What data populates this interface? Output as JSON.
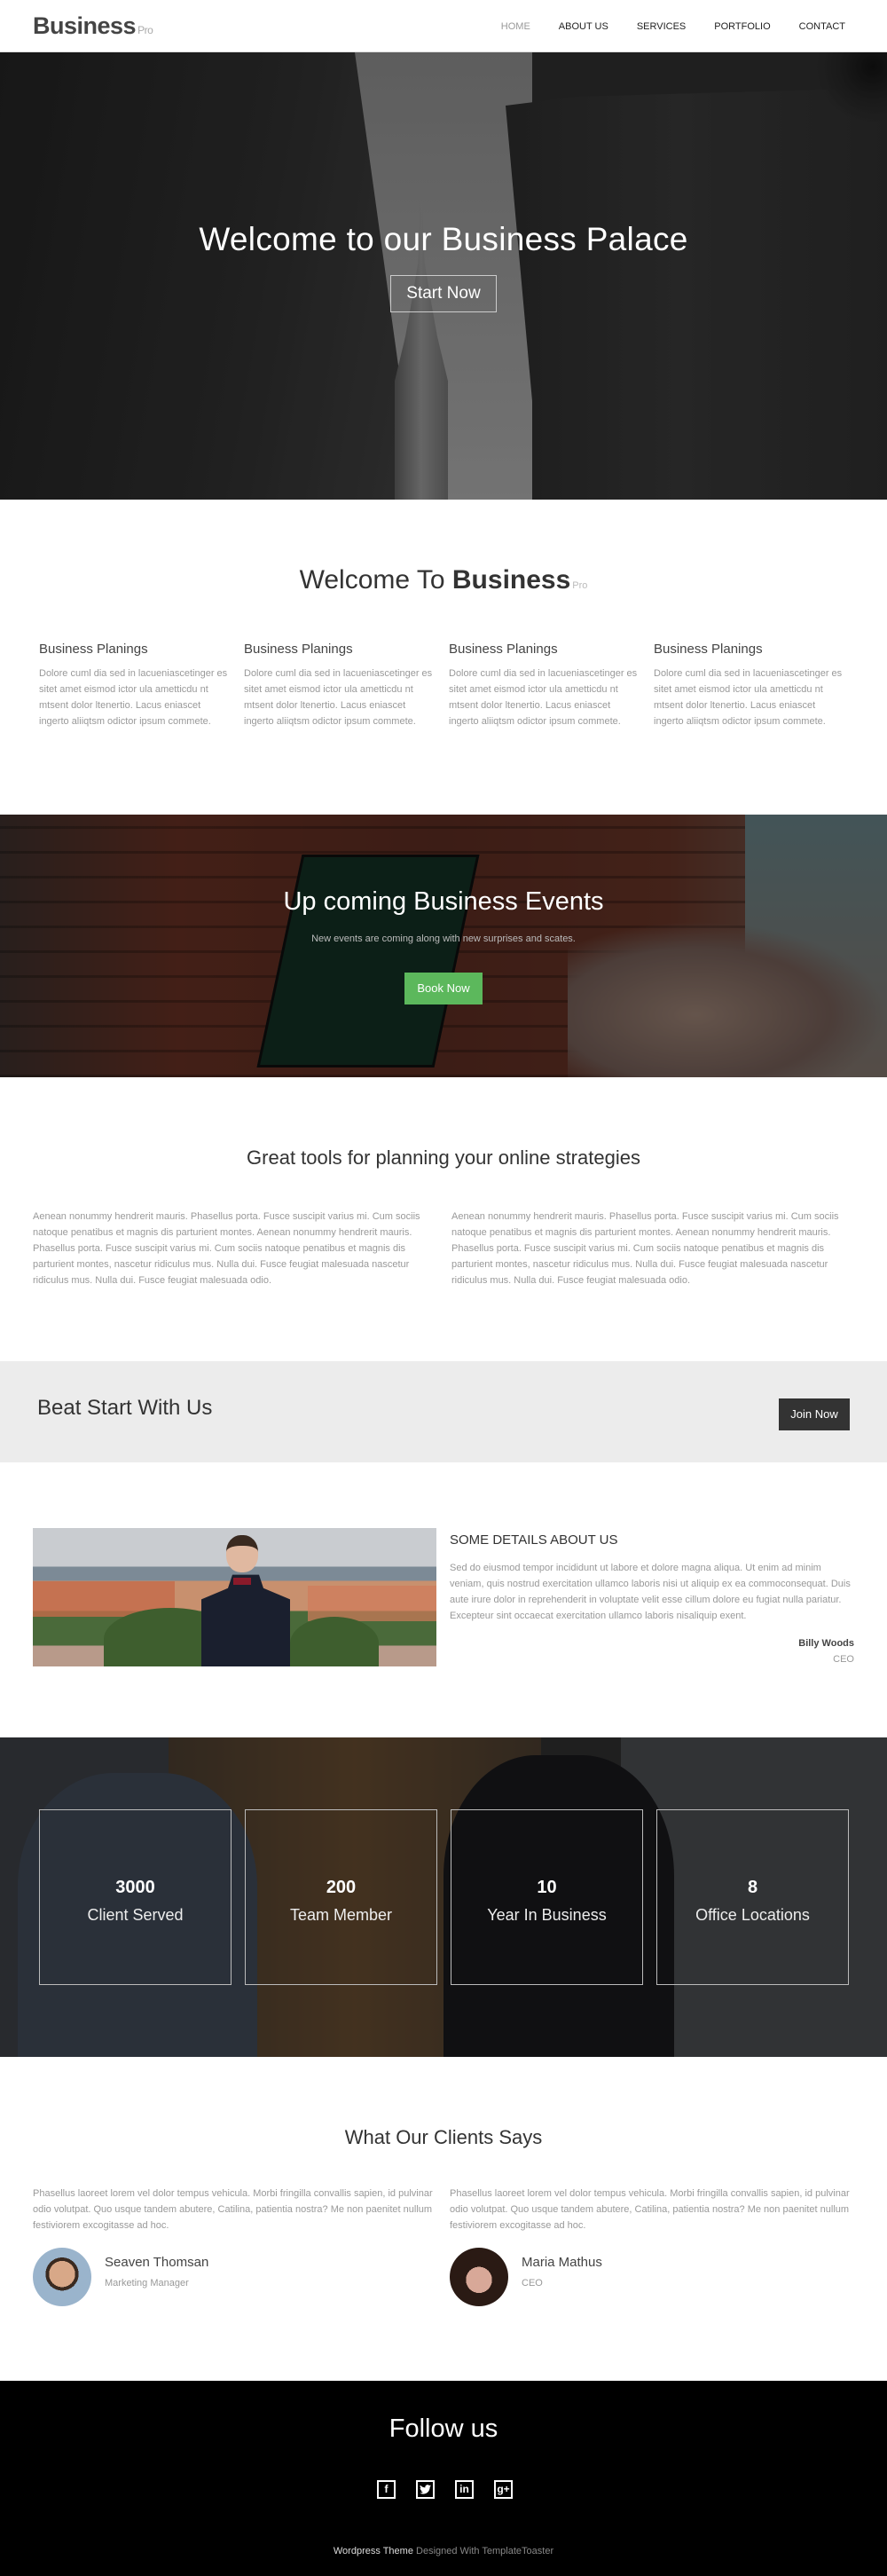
{
  "header": {
    "logo": "Business",
    "logo_sup": "Pro",
    "nav": [
      {
        "label": "HOME",
        "active": true
      },
      {
        "label": "ABOUT US",
        "active": false
      },
      {
        "label": "SERVICES",
        "active": false
      },
      {
        "label": "PORTFOLIO",
        "active": false
      },
      {
        "label": "CONTACT",
        "active": false
      }
    ]
  },
  "hero": {
    "title": "Welcome to our Business Palace",
    "button": "Start Now"
  },
  "welcome": {
    "title_prefix": "Welcome To",
    "title_bold": "Business",
    "title_sup": "Pro",
    "columns": [
      {
        "title": "Business Planings",
        "text": "Dolore cuml dia sed in lacueniascetinger es sitet amet eismod ictor ula ametticdu nt mtsent dolor ltenertio. Lacus eniascet ingerto aliiqtsm odictor ipsum commete."
      },
      {
        "title": "Business Planings",
        "text": "Dolore cuml dia sed in lacueniascetinger es sitet amet eismod ictor ula ametticdu nt mtsent dolor ltenertio. Lacus eniascet ingerto aliiqtsm odictor ipsum commete."
      },
      {
        "title": "Business Planings",
        "text": "Dolore cuml dia sed in lacueniascetinger es sitet amet eismod ictor ula ametticdu nt mtsent dolor ltenertio. Lacus eniascet ingerto aliiqtsm odictor ipsum commete."
      },
      {
        "title": "Business Planings",
        "text": "Dolore cuml dia sed in lacueniascetinger es sitet amet eismod ictor ula ametticdu nt mtsent dolor ltenertio. Lacus eniascet ingerto aliiqtsm odictor ipsum commete."
      }
    ]
  },
  "events": {
    "title": "Up coming Business Events",
    "subtitle": "New events are coming along with new surprises and scates.",
    "button": "Book Now",
    "button_color": "#5cb85c"
  },
  "tools": {
    "title": "Great tools for planning your online strategies",
    "paragraphs": [
      "Aenean nonummy hendrerit mauris. Phasellus porta. Fusce suscipit varius mi. Cum sociis natoque penatibus et magnis dis parturient montes. Aenean nonummy hendrerit mauris. Phasellus porta. Fusce suscipit varius mi. Cum sociis natoque penatibus et magnis dis parturient montes, nascetur ridiculus mus. Nulla dui. Fusce feugiat malesuada nascetur ridiculus mus. Nulla dui. Fusce feugiat malesuada odio.",
      "Aenean nonummy hendrerit mauris. Phasellus porta. Fusce suscipit varius mi. Cum sociis natoque penatibus et magnis dis parturient montes. Aenean nonummy hendrerit mauris. Phasellus porta. Fusce suscipit varius mi. Cum sociis natoque penatibus et magnis dis parturient montes, nascetur ridiculus mus. Nulla dui. Fusce feugiat malesuada nascetur ridiculus mus. Nulla dui. Fusce feugiat malesuada odio."
    ]
  },
  "cta": {
    "title": "Beat Start With Us",
    "button": "Join Now"
  },
  "about": {
    "title": "SOME DETAILS ABOUT US",
    "text": "Sed do eiusmod tempor incididunt ut labore et dolore magna aliqua. Ut enim ad minim veniam, quis nostrud exercitation ullamco laboris nisi ut aliquip ex ea commoconsequat. Duis aute irure dolor in reprehenderit in voluptate velit esse cillum dolore eu fugiat nulla pariatur. Excepteur sint occaecat exercitation ullamco laboris nisaliquip exent.",
    "author": "Billy Woods",
    "author_role": "CEO"
  },
  "stats": [
    {
      "value": "3000",
      "label": "Client Served"
    },
    {
      "value": "200",
      "label": "Team Member"
    },
    {
      "value": "10",
      "label": "Year In Business"
    },
    {
      "value": "8",
      "label": "Office Locations"
    }
  ],
  "clients": {
    "title": "What Our Clients Says",
    "testimonials": [
      {
        "text": "Phasellus laoreet lorem vel dolor tempus vehicula. Morbi fringilla convallis sapien, id pulvinar odio volutpat. Quo usque tandem abutere, Catilina, patientia nostra? Me non paenitet nullum festiviorem excogitasse ad hoc.",
        "name": "Seaven Thomsan",
        "role": "Marketing Manager"
      },
      {
        "text": "Phasellus laoreet lorem vel dolor tempus vehicula. Morbi fringilla convallis sapien, id pulvinar odio volutpat. Quo usque tandem abutere, Catilina, patientia nostra? Me non paenitet nullum festiviorem excogitasse ad hoc.",
        "name": "Maria Mathus",
        "role": "CEO"
      }
    ]
  },
  "footer": {
    "title": "Follow us",
    "social": [
      {
        "icon": "facebook-icon",
        "glyph": "f"
      },
      {
        "icon": "twitter-icon",
        "glyph": "t"
      },
      {
        "icon": "linkedin-icon",
        "glyph": "in"
      },
      {
        "icon": "google-plus-icon",
        "glyph": "g+"
      }
    ],
    "credit_a": "Wordpress Theme",
    "credit_b": " Designed With TemplateToaster"
  }
}
